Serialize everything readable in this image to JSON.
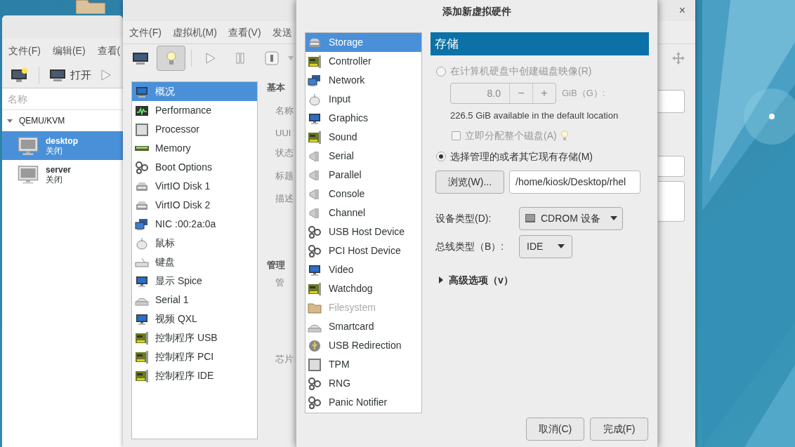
{
  "manager_window": {
    "menu": [
      "文件(F)",
      "编辑(E)",
      "查看("
    ],
    "open_button": "打开",
    "column_header": "名称",
    "connection": {
      "name": "QEMU/KVM",
      "expanded": true
    },
    "vms": [
      {
        "name": "desktop",
        "status": "关闭",
        "selected": true
      },
      {
        "name": "server",
        "status": "关闭",
        "selected": false
      }
    ]
  },
  "vm_window": {
    "close": "×",
    "menu": [
      "文件(F)",
      "虚拟机(M)",
      "查看(V)",
      "发送"
    ],
    "console_view": {
      "selected": false
    },
    "details_view": {
      "selected": true
    },
    "devices": [
      {
        "label": "概况",
        "selected": true
      },
      {
        "label": "Performance",
        "selected": false
      },
      {
        "label": "Processor",
        "selected": false
      },
      {
        "label": "Memory",
        "selected": false
      },
      {
        "label": "Boot Options",
        "selected": false
      },
      {
        "label": "VirtIO Disk 1",
        "selected": false
      },
      {
        "label": "VirtIO Disk 2",
        "selected": false
      },
      {
        "label": "NIC :00:2a:0a",
        "selected": false
      },
      {
        "label": "鼠标",
        "selected": false
      },
      {
        "label": "键盘",
        "selected": false
      },
      {
        "label": "显示 Spice",
        "selected": false
      },
      {
        "label": "Serial 1",
        "selected": false
      },
      {
        "label": "视频 QXL",
        "selected": false
      },
      {
        "label": "控制程序 USB",
        "selected": false
      },
      {
        "label": "控制程序 PCI",
        "selected": false
      },
      {
        "label": "控制程序 IDE",
        "selected": false
      }
    ],
    "labels": [
      {
        "text": "基本",
        "kind": "heading"
      },
      {
        "text": "名称",
        "kind": "field"
      },
      {
        "text": "UUI",
        "kind": "field"
      },
      {
        "text": "状态",
        "kind": "field"
      },
      {
        "text": "标题",
        "kind": "field"
      },
      {
        "text": "描述",
        "kind": "field"
      },
      {
        "text": "管理",
        "kind": "heading"
      },
      {
        "text": "管",
        "kind": "field"
      },
      {
        "text": "芯片",
        "kind": "field"
      }
    ]
  },
  "dialog": {
    "title": "添加新虚拟硬件",
    "hardware": [
      {
        "label": "Storage",
        "selected": true,
        "disabled": false
      },
      {
        "label": "Controller",
        "selected": false,
        "disabled": false
      },
      {
        "label": "Network",
        "selected": false,
        "disabled": false
      },
      {
        "label": "Input",
        "selected": false,
        "disabled": false
      },
      {
        "label": "Graphics",
        "selected": false,
        "disabled": false
      },
      {
        "label": "Sound",
        "selected": false,
        "disabled": false
      },
      {
        "label": "Serial",
        "selected": false,
        "disabled": false
      },
      {
        "label": "Parallel",
        "selected": false,
        "disabled": false
      },
      {
        "label": "Console",
        "selected": false,
        "disabled": false
      },
      {
        "label": "Channel",
        "selected": false,
        "disabled": false
      },
      {
        "label": "USB Host Device",
        "selected": false,
        "disabled": false
      },
      {
        "label": "PCI Host Device",
        "selected": false,
        "disabled": false
      },
      {
        "label": "Video",
        "selected": false,
        "disabled": false
      },
      {
        "label": "Watchdog",
        "selected": false,
        "disabled": false
      },
      {
        "label": "Filesystem",
        "selected": false,
        "disabled": true
      },
      {
        "label": "Smartcard",
        "selected": false,
        "disabled": false
      },
      {
        "label": "USB Redirection",
        "selected": false,
        "disabled": false
      },
      {
        "label": "TPM",
        "selected": false,
        "disabled": false
      },
      {
        "label": "RNG",
        "selected": false,
        "disabled": false
      },
      {
        "label": "Panic Notifier",
        "selected": false,
        "disabled": false
      }
    ],
    "section_title": "存储",
    "create_image": {
      "label": "在计算机硬盘中创建磁盘映像(R)",
      "selected": false,
      "disabled": true
    },
    "size": {
      "value": "8.0",
      "minus": "−",
      "plus": "+",
      "unit": "GiB（G）:",
      "disabled": true
    },
    "available": "226.5 GiB available in the default location",
    "allocate": {
      "label": "立即分配整个磁盘(A)",
      "checked": false,
      "disabled": true
    },
    "use_existing": {
      "label": "选择管理的或者其它现有存储(M)",
      "selected": true,
      "disabled": false
    },
    "browse_button": "浏览(W)...",
    "path": "/home/kiosk/Desktop/rhel",
    "device_type": {
      "label": "设备类型(D):",
      "value": "CDROM 设备"
    },
    "bus_type": {
      "label": "总线类型（B）:",
      "value": "IDE"
    },
    "advanced": {
      "label": "高级选项（v）",
      "expanded": false
    },
    "buttons": [
      "取消(C)",
      "完成(F)"
    ]
  }
}
